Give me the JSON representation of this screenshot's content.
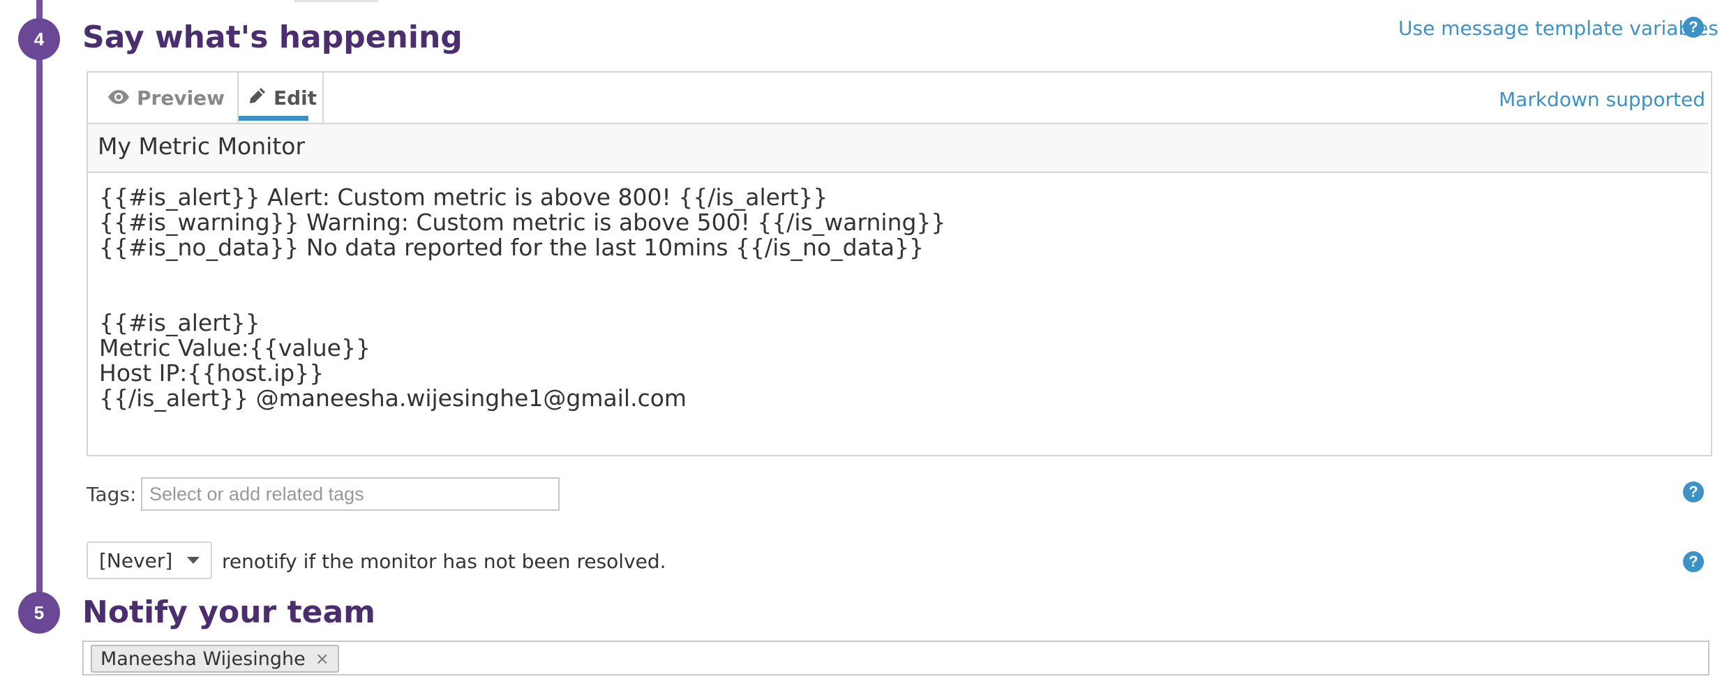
{
  "steps": {
    "say": {
      "number": "4",
      "title": "Say what's happening"
    },
    "notify": {
      "number": "5",
      "title": "Notify your team"
    }
  },
  "links": {
    "template_variables": "Use message template variables",
    "markdown": "Markdown supported"
  },
  "editor": {
    "tabs": {
      "preview": "Preview",
      "edit": "Edit"
    },
    "active_tab": "Edit",
    "subject": "My Metric Monitor",
    "body_lines": [
      "{{#is_alert}} Alert: Custom metric is above 800! {{/is_alert}}",
      "{{#is_warning}} Warning: Custom metric is above 500! {{/is_warning}}",
      "{{#is_no_data}} No data reported for the last 10mins {{/is_no_data}}",
      "",
      "",
      "{{#is_alert}}",
      "Metric Value:{{value}}",
      "Host IP:{{host.ip}}",
      "{{/is_alert}} @maneesha.wijesinghe1@gmail.com"
    ]
  },
  "tags": {
    "label": "Tags:",
    "placeholder": "Select or add related tags"
  },
  "renotify": {
    "selected": "[Never]",
    "text": "renotify if the monitor has not been resolved."
  },
  "notify": {
    "recipients": [
      "Maneesha Wijesinghe"
    ],
    "remove_glyph": "×"
  },
  "icons": {
    "help": "question-circle-icon",
    "preview": "eye-icon",
    "edit": "pencil-icon",
    "dropdown": "caret-down-icon",
    "remove": "close-icon"
  },
  "colors": {
    "step_badge": "#6b4896",
    "timeline": "#76539e",
    "section_title": "#4b2e6e",
    "link": "#3c92c4",
    "tab_underline": "#3c92c4"
  }
}
